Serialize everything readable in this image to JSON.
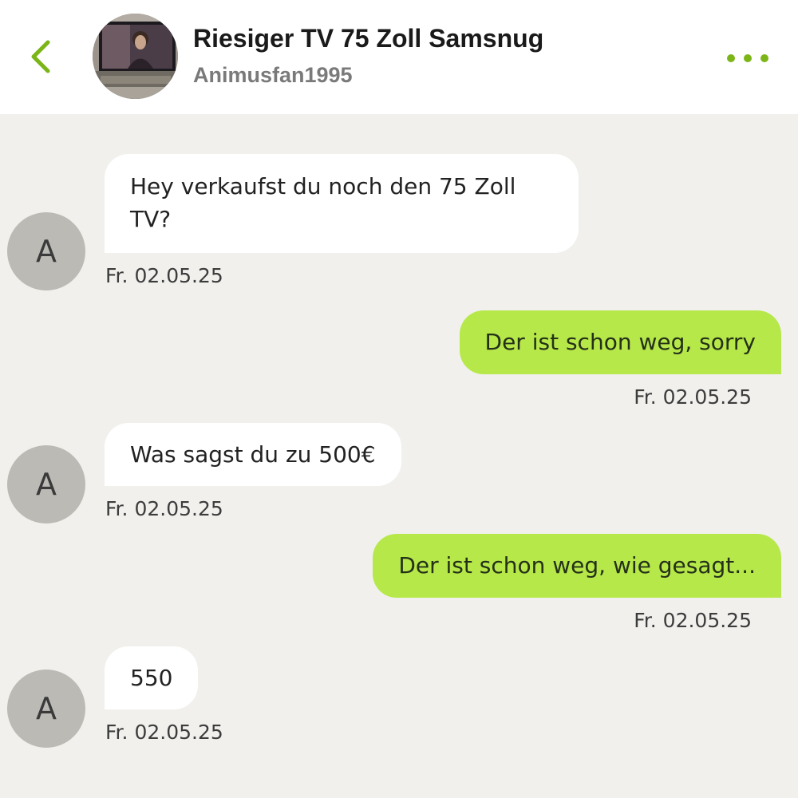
{
  "header": {
    "title": "Riesiger TV 75 Zoll Samsnug",
    "username": "Animusfan1995",
    "back_icon": "chevron-left-icon",
    "more_icon": "more-horizontal-icon",
    "accent_color": "#7cb518"
  },
  "messages": [
    {
      "direction": "in",
      "avatar_letter": "A",
      "text": "Hey verkaufst du noch den 75 Zoll TV?",
      "timestamp": "Fr. 02.05.25"
    },
    {
      "direction": "out",
      "text": "Der ist schon weg, sorry",
      "timestamp": "Fr. 02.05.25"
    },
    {
      "direction": "in",
      "avatar_letter": "A",
      "text": "Was sagst du zu 500€",
      "timestamp": "Fr. 02.05.25"
    },
    {
      "direction": "out",
      "text": "Der ist schon weg, wie gesagt...",
      "timestamp": "Fr. 02.05.25"
    },
    {
      "direction": "in",
      "avatar_letter": "A",
      "text": "550",
      "timestamp": "Fr. 02.05.25"
    }
  ],
  "colors": {
    "background": "#f1f0ed",
    "incoming_bubble": "#ffffff",
    "outgoing_bubble": "#b6e84a",
    "avatar": "#bcbab5"
  }
}
